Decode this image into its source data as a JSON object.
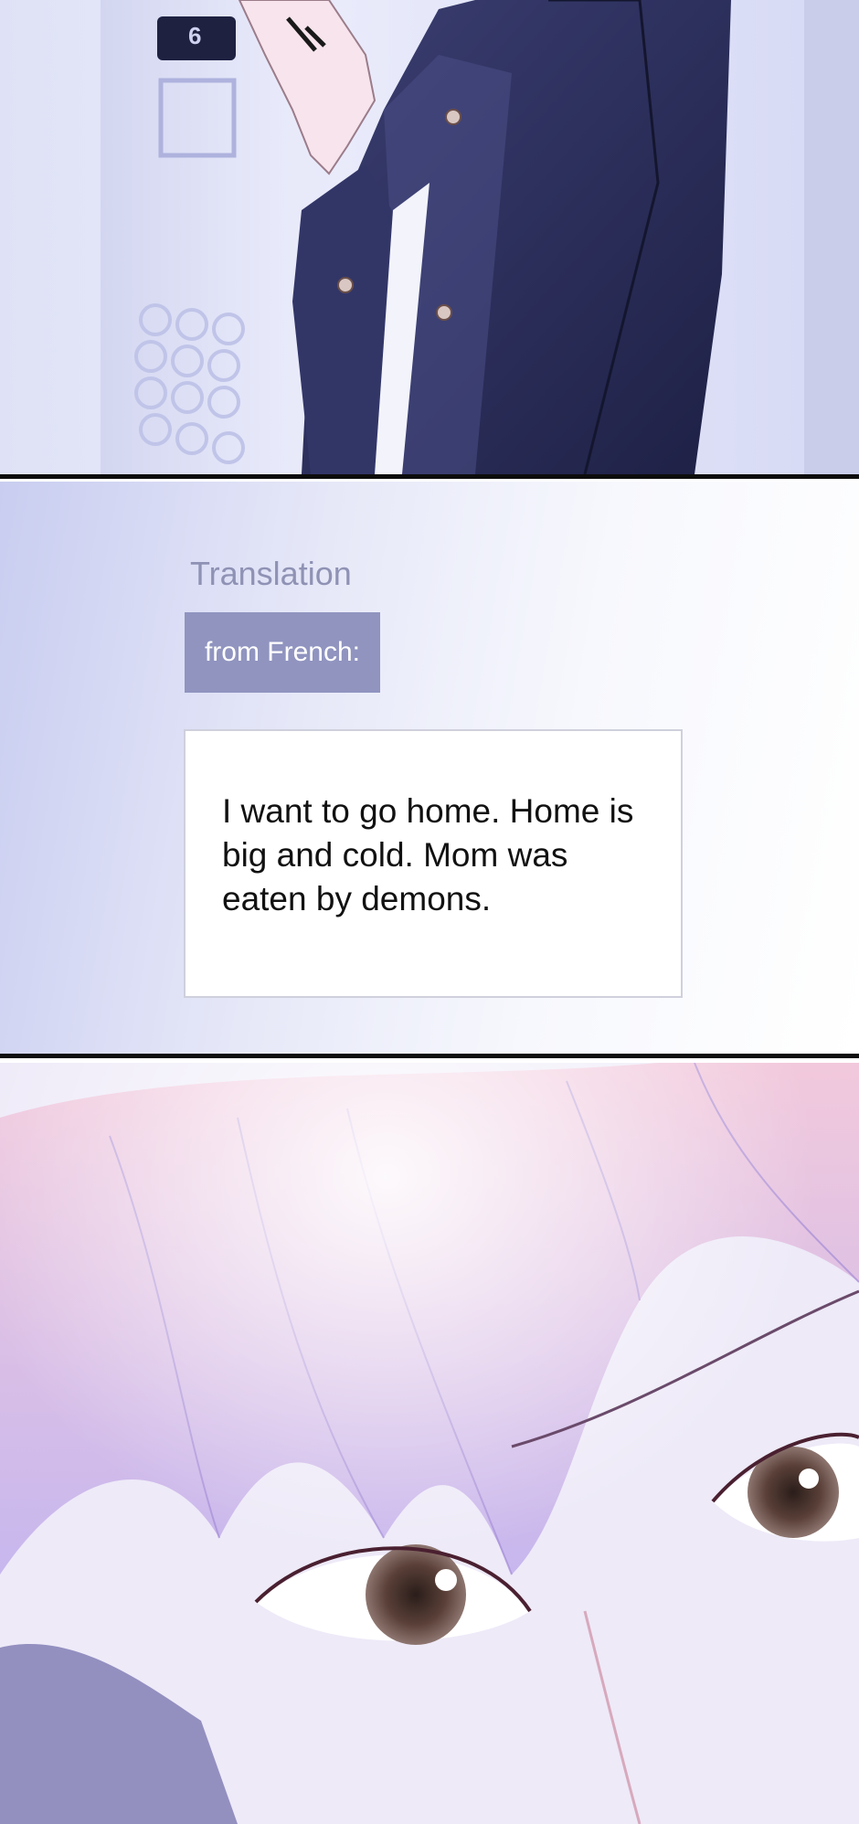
{
  "translation_card": {
    "heading": "Translation",
    "tag": "from French:",
    "text": "I want to go home. Home is big and cold. Mom was eaten by demons."
  },
  "elevator": {
    "floor_indicator": "6"
  },
  "colors": {
    "panel_border": "#0d0d0d",
    "tag_background": "#9094bf",
    "heading_text": "#8f92b4",
    "coat": "#2c2f5a"
  }
}
